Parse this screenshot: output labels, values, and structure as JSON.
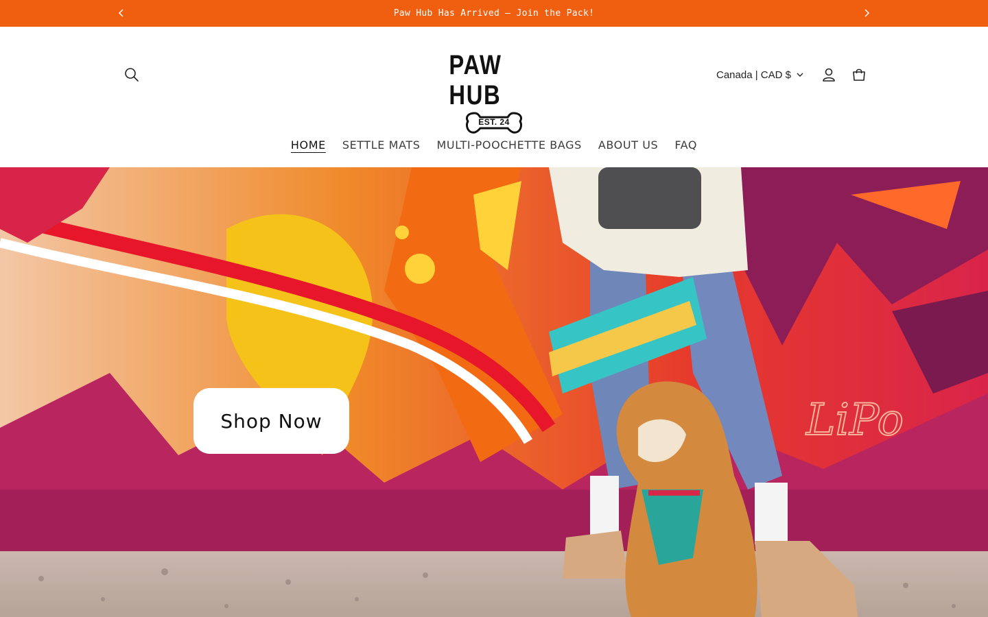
{
  "announcement": {
    "text": "Paw Hub Has Arrived – Join the Pack!",
    "prev_icon": "chevron-left-icon",
    "next_icon": "chevron-right-icon"
  },
  "header": {
    "logo_title": "PAW HUB",
    "logo_badge": "EST. 24",
    "country_selector": "Canada | CAD $",
    "icons": [
      "search-icon",
      "user-icon",
      "cart-icon",
      "chevron-down-icon"
    ]
  },
  "nav": {
    "items": [
      {
        "label": "HOME",
        "active": true
      },
      {
        "label": "SETTLE MATS",
        "active": false
      },
      {
        "label": "MULTI-POOCHETTE BAGS",
        "active": false
      },
      {
        "label": "ABOUT US",
        "active": false
      },
      {
        "label": "FAQ",
        "active": false
      }
    ]
  },
  "hero": {
    "button_label": "Shop Now",
    "mural_signature": "LiPo"
  },
  "colors": {
    "announcement_bg": "#f05e0f",
    "brand_text": "#111111",
    "hero_magenta": "#b8255f",
    "hero_orange": "#f26a12",
    "hero_yellow": "#f5c21a"
  }
}
